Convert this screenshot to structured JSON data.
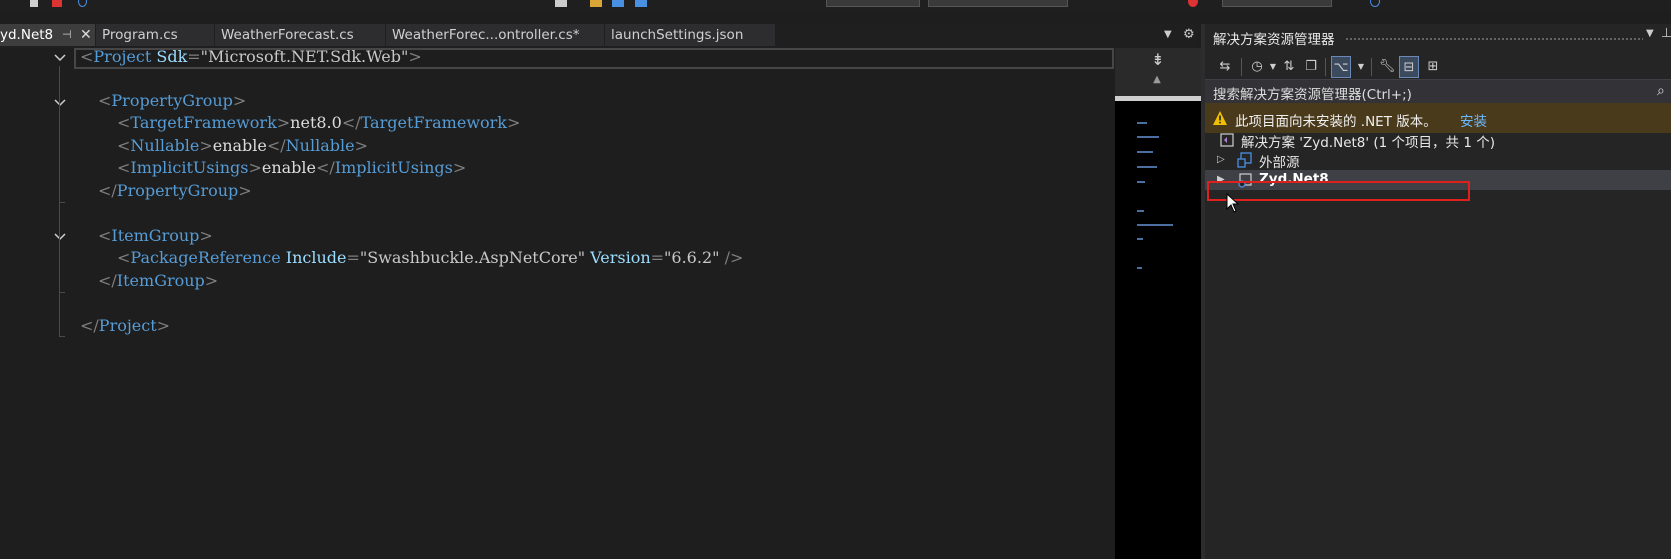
{
  "tabs": [
    {
      "label": "yd.Net8",
      "active": true
    },
    {
      "label": "Program.cs",
      "active": false
    },
    {
      "label": "WeatherForecast.cs",
      "active": false
    },
    {
      "label": "WeatherForec...ontroller.cs*",
      "active": false
    },
    {
      "label": "launchSettings.json",
      "active": false
    }
  ],
  "editor": {
    "lines": [
      {
        "pre": "",
        "open": "Project",
        "attrs": [
          {
            "name": "Sdk",
            "value": "\"Microsoft.NET.Sdk.Web\""
          }
        ],
        "selfclose": false
      },
      {
        "indent": "  ",
        "tag": "PropertyGroup"
      },
      {
        "indent": "    ",
        "tag": "TargetFramework",
        "text": "net8.0"
      },
      {
        "indent": "    ",
        "tag": "Nullable",
        "text": "enable"
      },
      {
        "indent": "    ",
        "tag": "ImplicitUsings",
        "text": "enable"
      },
      {
        "indent": "  ",
        "closetag": "PropertyGroup"
      },
      {
        "indent": "  ",
        "tag": "ItemGroup"
      },
      {
        "indent": "    ",
        "tag": "PackageReference",
        "attr1": "Include",
        "val1": "\"Swashbuckle.AspNetCore\"",
        "attr2": "Version",
        "val2": "\"6.6.2\""
      },
      {
        "indent": "  ",
        "closetag": "ItemGroup"
      },
      {
        "closetag": "Project"
      }
    ],
    "tokens": {
      "l1_open": "<",
      "l1_tag": "Project",
      "l1_attr": " Sdk",
      "l1_eq": "=",
      "l1_val": "\"Microsoft.NET.Sdk.Web\"",
      "l1_close": ">",
      "pg_open": "<",
      "pg_tag": "PropertyGroup",
      "pg_close": ">",
      "tf_o": "<",
      "tf_tag": "TargetFramework",
      "tf_c": ">",
      "tf_text": "net8.0",
      "tf_o2": "</",
      "tf_tag2": "TargetFramework",
      "tf_c2": ">",
      "nu_o": "<",
      "nu_tag": "Nullable",
      "nu_c": ">",
      "nu_text": "enable",
      "nu_o2": "</",
      "nu_tag2": "Nullable",
      "nu_c2": ">",
      "iu_o": "<",
      "iu_tag": "ImplicitUsings",
      "iu_c": ">",
      "iu_text": "enable",
      "iu_o2": "</",
      "iu_tag2": "ImplicitUsings",
      "iu_c2": ">",
      "pgc_o": "</",
      "pgc_tag": "PropertyGroup",
      "pgc_c": ">",
      "ig_o": "<",
      "ig_tag": "ItemGroup",
      "ig_c": ">",
      "pr_o": "<",
      "pr_tag": "PackageReference",
      "pr_a1": " Include",
      "pr_eq1": "=",
      "pr_v1": "\"Swashbuckle.AspNetCore\"",
      "pr_a2": " Version",
      "pr_eq2": "=",
      "pr_v2": "\"6.6.2\"",
      "pr_c": " />",
      "igc_o": "</",
      "igc_tag": "ItemGroup",
      "igc_c": ">",
      "pc_o": "</",
      "pc_tag": "Project",
      "pc_c": ">"
    }
  },
  "solution_explorer": {
    "title": "解决方案资源管理器",
    "search_placeholder": "搜索解决方案资源管理器(Ctrl+;)",
    "warning_text": "此项目面向未安装的 .NET 版本。",
    "warning_action": "安装",
    "tree": [
      {
        "label": "解决方案 'Zyd.Net8' (1 个项目，共 1 个)",
        "icon": "solution-icon"
      },
      {
        "label": "外部源",
        "icon": "external-sources-icon"
      },
      {
        "label": "Zyd.Net8",
        "icon": "project-icon",
        "selected": true
      }
    ]
  },
  "colors": {
    "tag": "#569cd6",
    "attribute": "#9cdcfe",
    "bracket": "#808080",
    "warning_bg": "#4a3a1c",
    "link": "#6cb8ff",
    "highlight": "#e0201c"
  }
}
